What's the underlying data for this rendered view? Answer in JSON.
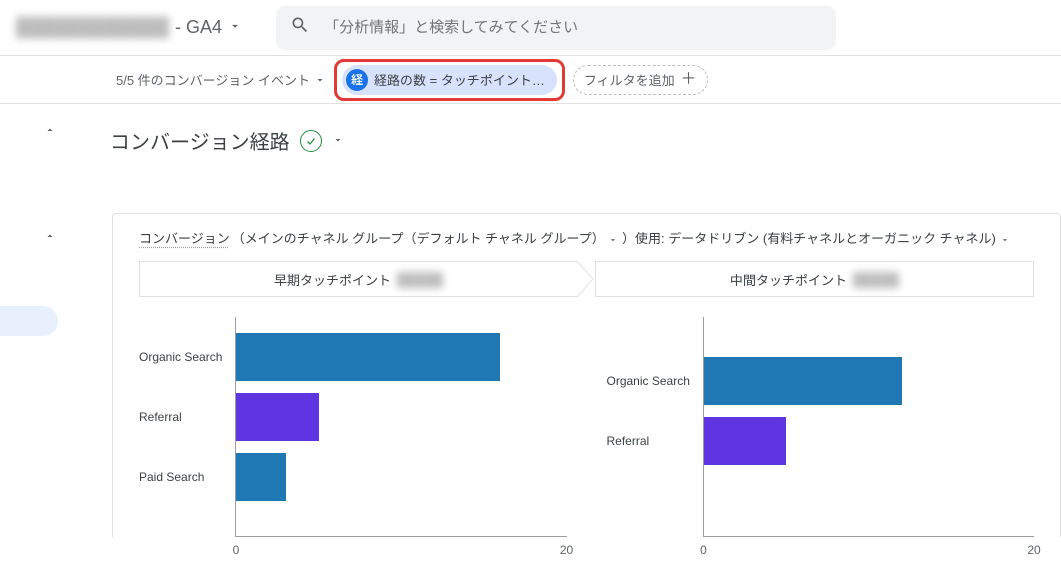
{
  "header": {
    "property_name_hidden": "████████████",
    "property_suffix": " - GA4",
    "search_placeholder": "「分析情報」と検索してみてください"
  },
  "filterbar": {
    "conversion_selector": "5/5 件のコンバージョン イベント",
    "active_filter_badge": "経",
    "active_filter_label": "経路の数 = タッチポイント…",
    "add_filter_label": "フィルタを追加"
  },
  "title": {
    "page_title": "コンバージョン経路"
  },
  "card": {
    "dimension_link": "コンバージョン",
    "group_prefix": "（メインのチャネル グループ（デフォルト チャネル グループ）",
    "group_suffix": "）使用: データドリブン (有料チャネルとオーガニック チャネル)",
    "touchpoint_left": "早期タッチポイント",
    "touchpoint_right": "中間タッチポイント",
    "touchpoint_hidden": "█████"
  },
  "chart_data": [
    {
      "type": "bar",
      "title": "早期タッチポイント",
      "categories": [
        "Organic Search",
        "Referral",
        "Paid Search"
      ],
      "values": [
        16,
        5,
        3
      ],
      "colors": [
        "#1f77b4",
        "#5e35e0",
        "#1f77b4"
      ],
      "xlabel": "",
      "ylabel": "",
      "xlim": [
        0,
        20
      ],
      "ticks": [
        0,
        20
      ]
    },
    {
      "type": "bar",
      "title": "中間タッチポイント",
      "categories": [
        "Organic Search",
        "Referral"
      ],
      "values": [
        12,
        5
      ],
      "colors": [
        "#1f77b4",
        "#5e35e0"
      ],
      "xlabel": "",
      "ylabel": "",
      "xlim": [
        0,
        20
      ],
      "ticks": [
        0,
        20
      ]
    }
  ]
}
